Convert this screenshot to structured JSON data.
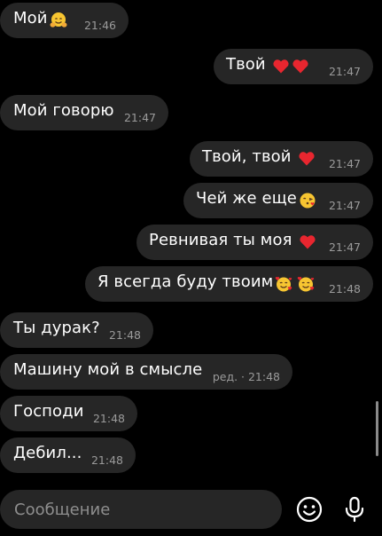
{
  "messages": [
    {
      "side": "in",
      "text": "Мой",
      "emojis": [
        "hugging-face"
      ],
      "time": "21:46"
    },
    {
      "side": "out",
      "text": "Твой",
      "emojis": [
        "red-heart",
        "red-heart"
      ],
      "time": "21:47"
    },
    {
      "side": "in",
      "text": "Мой говорю",
      "emojis": [],
      "time": "21:47"
    },
    {
      "side": "out",
      "text": "Твой, твой",
      "emojis": [
        "red-heart"
      ],
      "time": "21:47"
    },
    {
      "side": "out",
      "text": "Чей же еще",
      "emojis": [
        "face-blowing-kiss"
      ],
      "time": "21:47"
    },
    {
      "side": "out",
      "text": "Ревнивая ты моя",
      "emojis": [
        "red-heart"
      ],
      "time": "21:47"
    },
    {
      "side": "out",
      "text": "Я всегда буду твоим",
      "emojis": [
        "smiling-face-with-hearts",
        "smiling-face-with-hearts"
      ],
      "time": "21:48"
    },
    {
      "side": "in",
      "text": "Ты дурак?",
      "emojis": [],
      "time": "21:48"
    },
    {
      "side": "in",
      "text": "Машину мой в смысле",
      "emojis": [],
      "time": "ред. · 21:48"
    },
    {
      "side": "in",
      "text": "Господи",
      "emojis": [],
      "time": "21:48"
    },
    {
      "side": "in",
      "text": "Дебил...",
      "emojis": [],
      "time": "21:48"
    }
  ],
  "composer": {
    "placeholder": "Сообщение",
    "sticker_icon": "smiley-icon",
    "voice_icon": "microphone-icon"
  },
  "colors": {
    "background": "#000000",
    "bubble": "#262626",
    "time": "#9a9a9a",
    "heart": "#e8262f"
  }
}
